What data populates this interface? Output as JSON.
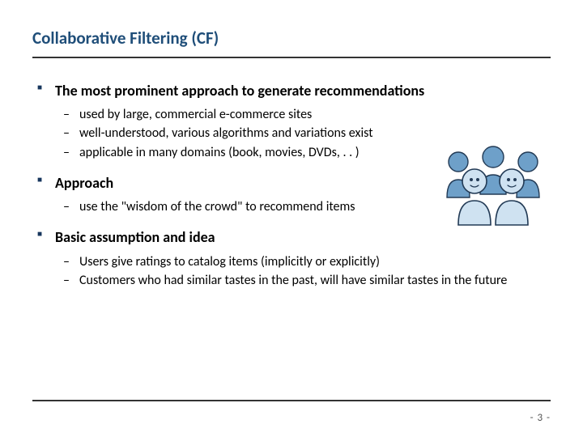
{
  "title": "Collaborative Filtering (CF)",
  "bullets": [
    {
      "head": "The most prominent approach to generate recommendations",
      "sub": [
        "used by large, commercial e-commerce sites",
        "well-understood, various algorithms and variations exist",
        "applicable in many domains (book, movies, DVDs, . . )"
      ]
    },
    {
      "head": "Approach",
      "sub": [
        "use the \"wisdom of the crowd\" to recommend items"
      ]
    },
    {
      "head": "Basic assumption and idea",
      "sub": [
        "Users give ratings to catalog items (implicitly or explicitly)",
        "Customers who had similar tastes in the past, will have similar tastes in the future"
      ]
    }
  ],
  "page_label": "- 3 -",
  "icon_name": "people-group-icon"
}
